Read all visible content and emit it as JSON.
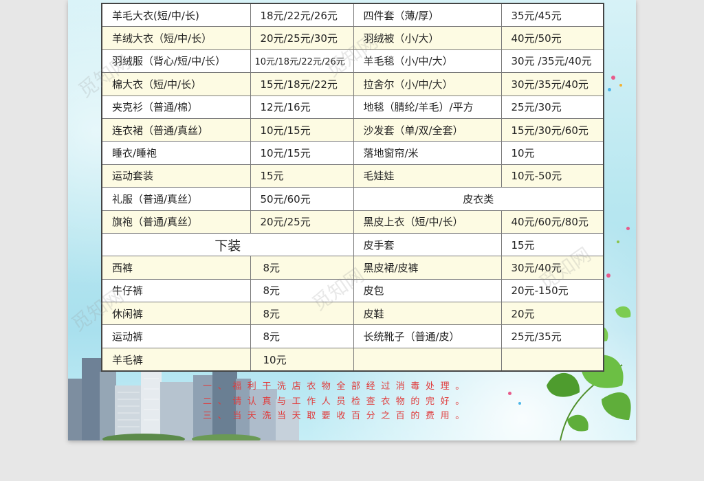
{
  "rows": [
    [
      "羊毛大衣(短/中/长)",
      "18元/22元/26元",
      "四件套（薄/厚）",
      "35元/45元"
    ],
    [
      "羊绒大衣（短/中/长）",
      "20元/25元/30元",
      "羽绒被（小/大）",
      "40元/50元"
    ],
    [
      "羽绒服（背心/短/中/长）",
      "10元/18元/22元/26元",
      "羊毛毯（小/中/大）",
      "30元 /35元/40元"
    ],
    [
      "棉大衣（短/中/长）",
      "15元/18元/22元",
      "拉舍尔（小/中/大）",
      "30元/35元/40元"
    ],
    [
      "夹克衫（普通/棉）",
      "12元/16元",
      "地毯（腈纶/羊毛）/平方",
      "25元/30元"
    ],
    [
      "连衣裙（普通/真丝）",
      "10元/15元",
      "沙发套（单/双/全套）",
      "15元/30元/60元"
    ],
    [
      "睡衣/睡袍",
      "10元/15元",
      "落地窗帘/米",
      "10元"
    ],
    [
      "运动套装",
      "15元",
      "毛娃娃",
      "10元-50元"
    ],
    [
      "礼服（普通/真丝）",
      "50元/60元",
      "",
      ""
    ],
    [
      "旗袍（普通/真丝）",
      "20元/25元",
      "黑皮上衣（短/中/长）",
      "40元/60元/80元"
    ],
    [
      "",
      "",
      "皮手套",
      "15元"
    ],
    [
      "西裤",
      "8元",
      "黑皮裙/皮裤",
      "30元/40元"
    ],
    [
      "牛仔裤",
      "8元",
      "皮包",
      "20元-150元"
    ],
    [
      "休闲裤",
      "8元",
      "皮鞋",
      "20元"
    ],
    [
      "运动裤",
      "8元",
      "长统靴子（普通/皮）",
      "25元/35元"
    ],
    [
      "羊毛裤",
      "10元",
      "",
      ""
    ]
  ],
  "sections": {
    "leather": "皮衣类",
    "bottoms": "下装"
  },
  "notes": [
    "一、福利干洗店衣物全部经过消毒处理。",
    "二、请认真与工作人员检查衣物的完好。",
    "三、当天洗当天取要收百分之百的费用。"
  ],
  "watermark": "觅知网",
  "colors": {
    "note_text": "#e03a3a",
    "row_highlight": "#fdfbe3"
  }
}
